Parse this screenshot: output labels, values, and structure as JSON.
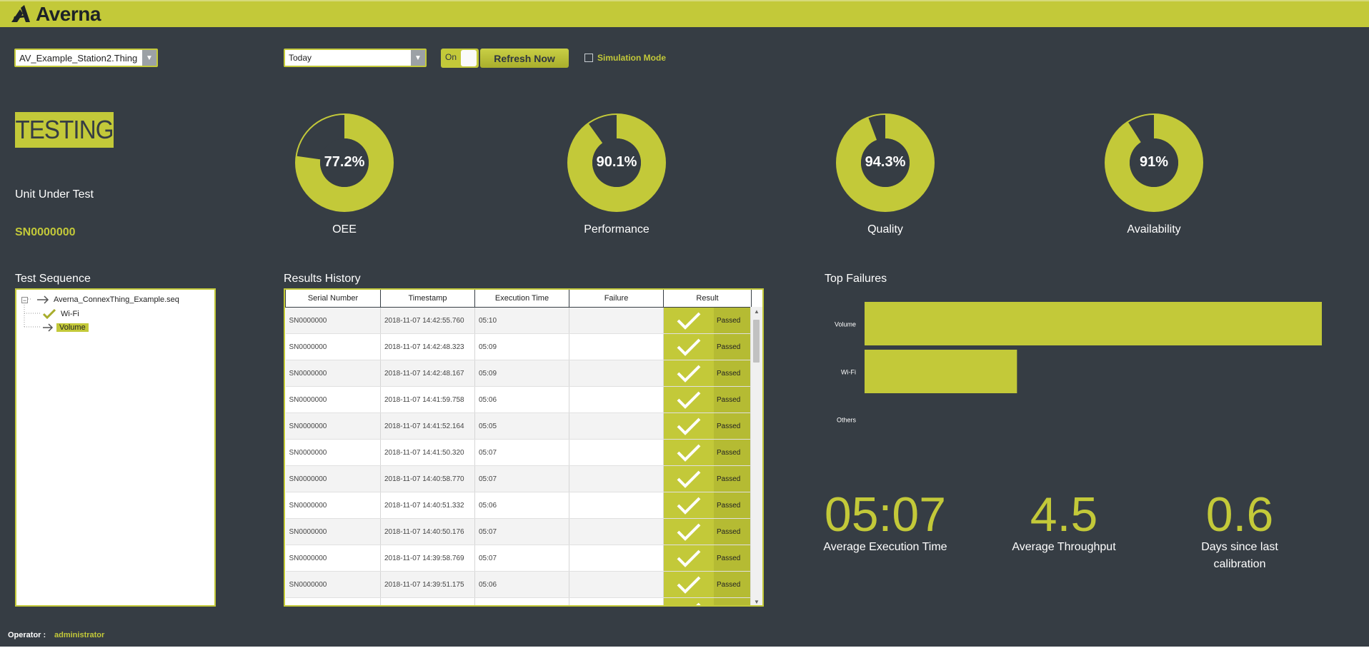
{
  "header": {
    "brand": "Averna"
  },
  "toolbar": {
    "station": "AV_Example_Station2.Thing",
    "period": "Today",
    "toggle_label": "On",
    "refresh_label": "Refresh Now",
    "simulation_label": "Simulation Mode",
    "simulation_checked": false
  },
  "status": {
    "badge": "TESTING",
    "uut_label": "Unit Under Test",
    "uut_value": "SN0000000"
  },
  "gauges": [
    {
      "label": "OEE",
      "value_text": "77.2%",
      "value": 77.2
    },
    {
      "label": "Performance",
      "value_text": "90.1%",
      "value": 90.1
    },
    {
      "label": "Quality",
      "value_text": "94.3%",
      "value": 94.3
    },
    {
      "label": "Availability",
      "value_text": "91%",
      "value": 91
    }
  ],
  "sequence": {
    "title": "Test Sequence",
    "root": "Averna_ConnexThing_Example.seq",
    "items": [
      "Wi-Fi",
      "Volume"
    ]
  },
  "results": {
    "title": "Results History",
    "columns": [
      "Serial Number",
      "Timestamp",
      "Execution Time",
      "Failure",
      "Result"
    ],
    "rows": [
      [
        "SN0000000",
        "2018-11-07 14:42:55.760",
        "05:10",
        "",
        "Passed"
      ],
      [
        "SN0000000",
        "2018-11-07 14:42:48.323",
        "05:09",
        "",
        "Passed"
      ],
      [
        "SN0000000",
        "2018-11-07 14:42:48.167",
        "05:09",
        "",
        "Passed"
      ],
      [
        "SN0000000",
        "2018-11-07 14:41:59.758",
        "05:06",
        "",
        "Passed"
      ],
      [
        "SN0000000",
        "2018-11-07 14:41:52.164",
        "05:05",
        "",
        "Passed"
      ],
      [
        "SN0000000",
        "2018-11-07 14:41:50.320",
        "05:07",
        "",
        "Passed"
      ],
      [
        "SN0000000",
        "2018-11-07 14:40:58.770",
        "05:07",
        "",
        "Passed"
      ],
      [
        "SN0000000",
        "2018-11-07 14:40:51.332",
        "05:06",
        "",
        "Passed"
      ],
      [
        "SN0000000",
        "2018-11-07 14:40:50.176",
        "05:07",
        "",
        "Passed"
      ],
      [
        "SN0000000",
        "2018-11-07 14:39:58.769",
        "05:07",
        "",
        "Passed"
      ],
      [
        "SN0000000",
        "2018-11-07 14:39:51.175",
        "05:06",
        "",
        "Passed"
      ],
      [
        "",
        "",
        "",
        "",
        ""
      ]
    ]
  },
  "failures": {
    "title": "Top Failures",
    "chart_data": {
      "type": "bar",
      "orientation": "horizontal",
      "categories": [
        "Volume",
        "Wi-Fi",
        "Others"
      ],
      "values": [
        3,
        1,
        0
      ],
      "title": "Top Failures"
    }
  },
  "kpis": [
    {
      "value": "05:07",
      "label": "Average Execution Time"
    },
    {
      "value": "4.5",
      "label": "Average Throughput"
    },
    {
      "value": "0.6",
      "label": "Days since last calibration"
    }
  ],
  "footer": {
    "operator_label": "Operator :",
    "operator": "administrator"
  },
  "colors": {
    "accent": "#c3c939",
    "background": "#363d44",
    "text": "#ffffff"
  }
}
